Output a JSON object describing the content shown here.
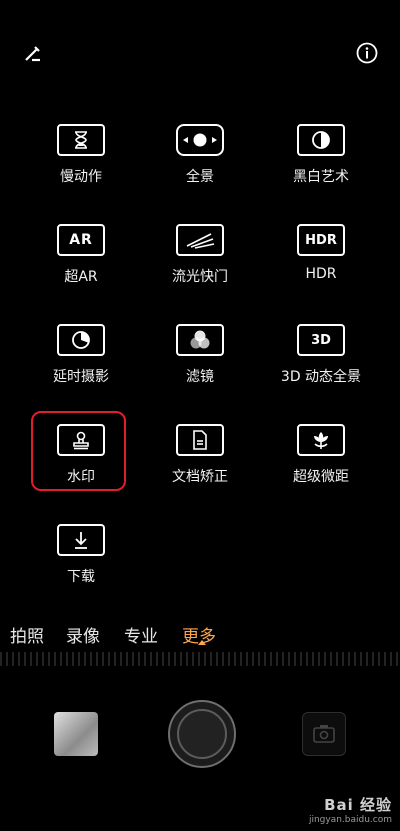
{
  "top": {
    "edit_icon": "edit-pencil-icon",
    "info_icon": "info-icon"
  },
  "modes_grid": [
    {
      "label": "慢动作",
      "icon": "hourglass-icon"
    },
    {
      "label": "全景",
      "icon": "panorama-icon"
    },
    {
      "label": "黑白艺术",
      "icon": "contrast-icon"
    },
    {
      "label": "超AR",
      "icon": "ar-icon"
    },
    {
      "label": "流光快门",
      "icon": "light-trail-icon"
    },
    {
      "label": "HDR",
      "icon": "hdr-icon",
      "icon_text": "HDR"
    },
    {
      "label": "延时摄影",
      "icon": "timelapse-icon"
    },
    {
      "label": "滤镜",
      "icon": "filter-icon"
    },
    {
      "label": "3D 动态全景",
      "icon": "3d-icon",
      "icon_text": "3D"
    },
    {
      "label": "水印",
      "icon": "stamp-icon"
    },
    {
      "label": "文档矫正",
      "icon": "document-icon"
    },
    {
      "label": "超级微距",
      "icon": "flower-macro-icon"
    },
    {
      "label": "下载",
      "icon": "download-icon"
    }
  ],
  "mode_bar": [
    "拍照",
    "录像",
    "专业",
    "更多"
  ],
  "mode_bar_active": "更多",
  "ar_icon_text": "AR",
  "watermark": {
    "logo": "Bai 经验",
    "url": "jingyan.baidu.com"
  },
  "colors": {
    "accent": "#ffa64d",
    "highlight": "#e31d2b"
  }
}
